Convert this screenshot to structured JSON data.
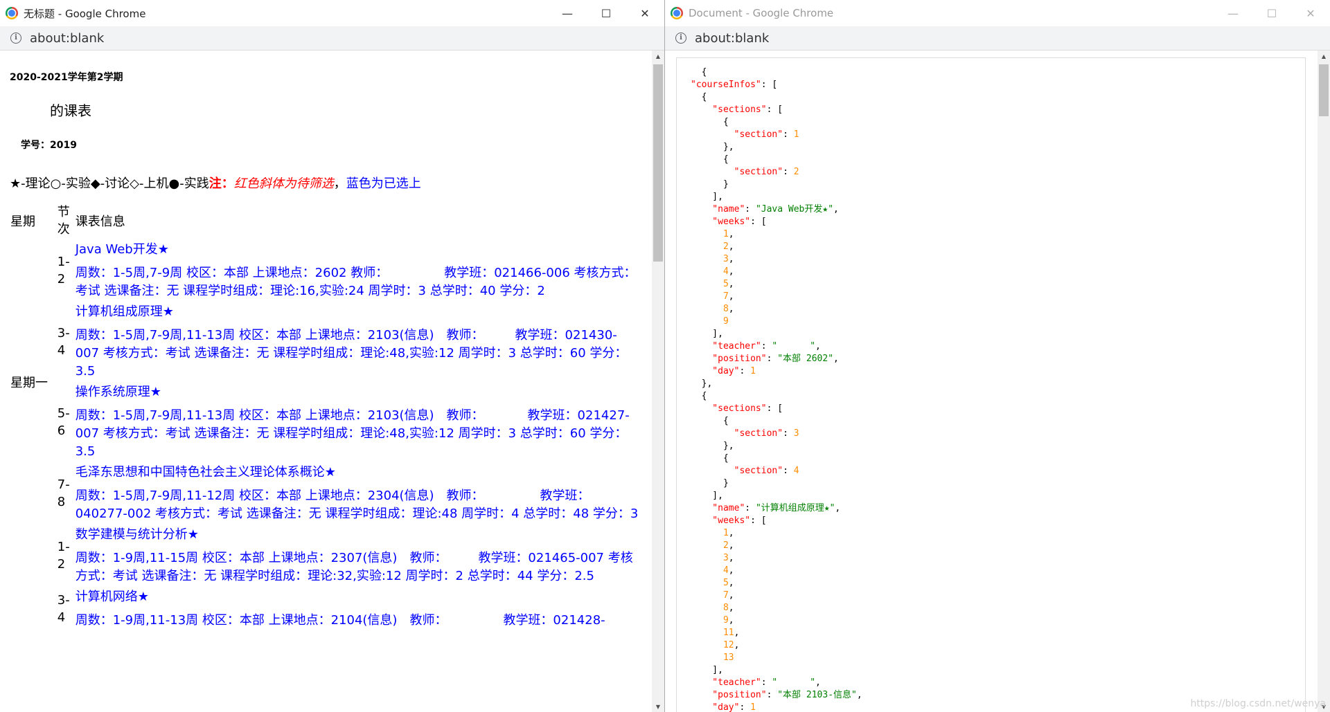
{
  "left_window": {
    "title": "无标题 - Google Chrome",
    "url": "about:blank",
    "controls": {
      "minimize": "—",
      "maximize": "☐",
      "close": "✕"
    },
    "page": {
      "term": "2020-2021学年第2学期",
      "schedule_title": "的课表",
      "student_no": "学号：2019",
      "legend": {
        "symbols": "★-理论○-实验◆-讨论◇-上机●-实践",
        "note_label": "注：",
        "red_text": "红色斜体为待筛选",
        "sep": "，",
        "blue_text": "蓝色为已选上"
      },
      "headers": {
        "weekday": "星期",
        "section": "节次",
        "info": "课表信息"
      },
      "weekday_monday": "星期一",
      "courses": [
        {
          "section": "1-2",
          "name": "Java Web开发★",
          "details": "周数：1-5周,7-9周 校区：本部 上课地点：2602 教师：　　　　　教学班：021466-006 考核方式：考试 选课备注：无 课程学时组成：理论:16,实验:24 周学时：3 总学时：40 学分：2"
        },
        {
          "section": "3-4",
          "name": "计算机组成原理★",
          "details": "周数：1-5周,7-9周,11-13周 校区：本部 上课地点：2103(信息)　教师：　　　教学班：021430-007 考核方式：考试 选课备注：无 课程学时组成：理论:48,实验:12 周学时：3 总学时：60 学分：3.5"
        },
        {
          "section": "5-6",
          "name": "操作系统原理★",
          "details": "周数：1-5周,7-9周,11-13周 校区：本部 上课地点：2103(信息)　教师：　　　　教学班：021427-007 考核方式：考试 选课备注：无 课程学时组成：理论:48,实验:12 周学时：3 总学时：60 学分：3.5"
        },
        {
          "section": "7-8",
          "name": "毛泽东思想和中国特色社会主义理论体系概论★",
          "details": "周数：1-5周,7-9周,11-12周 校区：本部 上课地点：2304(信息)　教师：　　　　　教学班：040277-002 考核方式：考试 选课备注：无 课程学时组成：理论:48 周学时：4 总学时：48 学分：3"
        },
        {
          "section": "1-2",
          "name": "数学建模与统计分析★",
          "details": "周数：1-9周,11-15周 校区：本部 上课地点：2307(信息)　教师：　　　教学班：021465-007 考核方式：考试 选课备注：无 课程学时组成：理论:32,实验:12 周学时：2 总学时：44 学分：2.5"
        },
        {
          "section": "3-4",
          "name": "计算机网络★",
          "details": "周数：1-9周,11-13周 校区：本部 上课地点：2104(信息)　教师：　　　　　教学班：021428-"
        }
      ]
    }
  },
  "right_window": {
    "title": "Document - Google Chrome",
    "url": "about:blank",
    "controls": {
      "minimize": "—",
      "maximize": "☐",
      "close": "✕"
    },
    "json_lines": [
      [
        [
          "  {",
          ""
        ]
      ],
      [
        [
          "\"courseInfos\"",
          "k"
        ],
        [
          ": [",
          ""
        ]
      ],
      [
        [
          "  {",
          ""
        ]
      ],
      [
        [
          "    \"sections\"",
          "k"
        ],
        [
          ": [",
          ""
        ]
      ],
      [
        [
          "      {",
          ""
        ]
      ],
      [
        [
          "        \"section\"",
          "k"
        ],
        [
          ": ",
          ""
        ],
        [
          "1",
          "n"
        ]
      ],
      [
        [
          "      },",
          ""
        ]
      ],
      [
        [
          "      {",
          ""
        ]
      ],
      [
        [
          "        \"section\"",
          "k"
        ],
        [
          ": ",
          ""
        ],
        [
          "2",
          "n"
        ]
      ],
      [
        [
          "      }",
          ""
        ]
      ],
      [
        [
          "    ],",
          ""
        ]
      ],
      [
        [
          "    \"name\"",
          "k"
        ],
        [
          ": ",
          ""
        ],
        [
          "\"Java Web开发★\"",
          "s"
        ],
        [
          ",",
          ""
        ]
      ],
      [
        [
          "    \"weeks\"",
          "k"
        ],
        [
          ": [",
          ""
        ]
      ],
      [
        [
          "      1",
          "n"
        ],
        [
          ",",
          ""
        ]
      ],
      [
        [
          "      2",
          "n"
        ],
        [
          ",",
          ""
        ]
      ],
      [
        [
          "      3",
          "n"
        ],
        [
          ",",
          ""
        ]
      ],
      [
        [
          "      4",
          "n"
        ],
        [
          ",",
          ""
        ]
      ],
      [
        [
          "      5",
          "n"
        ],
        [
          ",",
          ""
        ]
      ],
      [
        [
          "      7",
          "n"
        ],
        [
          ",",
          ""
        ]
      ],
      [
        [
          "      8",
          "n"
        ],
        [
          ",",
          ""
        ]
      ],
      [
        [
          "      9",
          "n"
        ]
      ],
      [
        [
          "    ],",
          ""
        ]
      ],
      [
        [
          "    \"teacher\"",
          "k"
        ],
        [
          ": ",
          ""
        ],
        [
          "\"      \"",
          "s"
        ],
        [
          ",",
          ""
        ]
      ],
      [
        [
          "    \"position\"",
          "k"
        ],
        [
          ": ",
          ""
        ],
        [
          "\"本部 2602\"",
          "s"
        ],
        [
          ",",
          ""
        ]
      ],
      [
        [
          "    \"day\"",
          "k"
        ],
        [
          ": ",
          ""
        ],
        [
          "1",
          "n"
        ]
      ],
      [
        [
          "  },",
          ""
        ]
      ],
      [
        [
          "  {",
          ""
        ]
      ],
      [
        [
          "    \"sections\"",
          "k"
        ],
        [
          ": [",
          ""
        ]
      ],
      [
        [
          "      {",
          ""
        ]
      ],
      [
        [
          "        \"section\"",
          "k"
        ],
        [
          ": ",
          ""
        ],
        [
          "3",
          "n"
        ]
      ],
      [
        [
          "      },",
          ""
        ]
      ],
      [
        [
          "      {",
          ""
        ]
      ],
      [
        [
          "        \"section\"",
          "k"
        ],
        [
          ": ",
          ""
        ],
        [
          "4",
          "n"
        ]
      ],
      [
        [
          "      }",
          ""
        ]
      ],
      [
        [
          "    ],",
          ""
        ]
      ],
      [
        [
          "    \"name\"",
          "k"
        ],
        [
          ": ",
          ""
        ],
        [
          "\"计算机组成原理★\"",
          "s"
        ],
        [
          ",",
          ""
        ]
      ],
      [
        [
          "    \"weeks\"",
          "k"
        ],
        [
          ": [",
          ""
        ]
      ],
      [
        [
          "      1",
          "n"
        ],
        [
          ",",
          ""
        ]
      ],
      [
        [
          "      2",
          "n"
        ],
        [
          ",",
          ""
        ]
      ],
      [
        [
          "      3",
          "n"
        ],
        [
          ",",
          ""
        ]
      ],
      [
        [
          "      4",
          "n"
        ],
        [
          ",",
          ""
        ]
      ],
      [
        [
          "      5",
          "n"
        ],
        [
          ",",
          ""
        ]
      ],
      [
        [
          "      7",
          "n"
        ],
        [
          ",",
          ""
        ]
      ],
      [
        [
          "      8",
          "n"
        ],
        [
          ",",
          ""
        ]
      ],
      [
        [
          "      9",
          "n"
        ],
        [
          ",",
          ""
        ]
      ],
      [
        [
          "      11",
          "n"
        ],
        [
          ",",
          ""
        ]
      ],
      [
        [
          "      12",
          "n"
        ],
        [
          ",",
          ""
        ]
      ],
      [
        [
          "      13",
          "n"
        ]
      ],
      [
        [
          "    ],",
          ""
        ]
      ],
      [
        [
          "    \"teacher\"",
          "k"
        ],
        [
          ": ",
          ""
        ],
        [
          "\"      \"",
          "s"
        ],
        [
          ",",
          ""
        ]
      ],
      [
        [
          "    \"position\"",
          "k"
        ],
        [
          ": ",
          ""
        ],
        [
          "\"本部 2103-信息\"",
          "s"
        ],
        [
          ",",
          ""
        ]
      ],
      [
        [
          "    \"day\"",
          "k"
        ],
        [
          ": ",
          ""
        ],
        [
          "1",
          "n"
        ]
      ]
    ],
    "watermark": "https://blog.csdn.net/wenya"
  }
}
